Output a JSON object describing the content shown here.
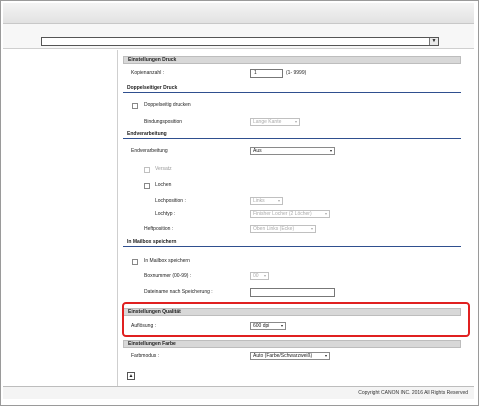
{
  "top": {
    "select_value": ""
  },
  "druck": {
    "header": "Einstellungen Druck",
    "kopien_label": "Kopienanzahl :",
    "kopien_value": "1",
    "kopien_range": "(1- 9999)"
  },
  "duplex": {
    "header": "Doppelseitiger Druck",
    "checkbox_label": "Doppelseitig drucken",
    "bindung_label": "Bindungsposition",
    "bindung_value": "Lange Kante"
  },
  "endverarbeitung": {
    "header": "Endverarbeitung",
    "label": "Endverarbeitung",
    "value": "Aus",
    "versatz_label": "Versatz",
    "lochen_label": "Lochen",
    "lochposition_label": "Lochposition :",
    "lochposition_value": "Links",
    "lochtyp_label": "Lochtyp :",
    "lochtyp_value": "Finisher Locher (2 Löcher)",
    "heftposition_label": "Heftposition :",
    "heftposition_value": "Oben Links (Ecke)"
  },
  "mailbox": {
    "header": "In Mailbox speichern",
    "checkbox_label": "In Mailbox speichern",
    "boxnummer_label": "Boxnummer (00-99) :",
    "boxnummer_value": "00",
    "dateiname_label": "Dateiname nach Speicherung :",
    "dateiname_value": ""
  },
  "qualitaet": {
    "header": "Einstellungen Qualität",
    "aufloesung_label": "Auflösung :",
    "aufloesung_value": "600 dpi"
  },
  "farbe": {
    "header": "Einstellungen Farbe",
    "farbmodus_label": "Farbmodus :",
    "farbmodus_value": "Auto (Farbe/Schwarzweiß)"
  },
  "footer": {
    "copyright": "Copyright CANON INC. 2016 All Rights Reserved"
  },
  "colors": {
    "highlight": "#e02020",
    "section_line": "#2f4f8f"
  }
}
